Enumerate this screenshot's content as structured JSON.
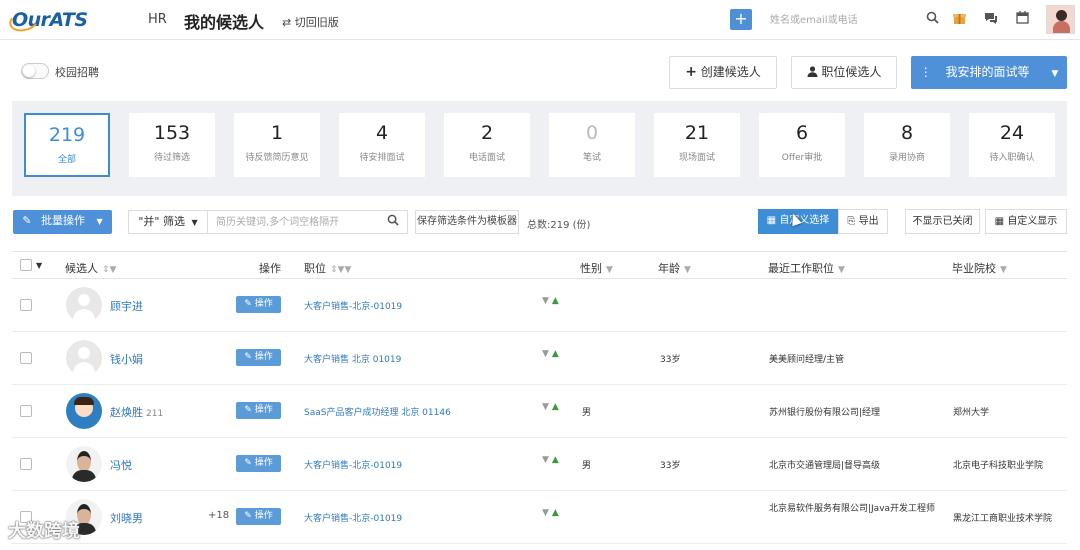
{
  "header": {
    "logo": "OurATS",
    "role": "HR",
    "title": "我的候选人",
    "switch_old": "切回旧版",
    "search_placeholder": "姓名或email或电话",
    "add_label": "+"
  },
  "toolbar": {
    "campus_toggle_label": "校园招聘",
    "create_candidate": "创建候选人",
    "position_candidates": "职位候选人",
    "my_interviews": "我安排的面试等"
  },
  "stats": [
    {
      "num": "219",
      "label": "全部"
    },
    {
      "num": "153",
      "label": "待过筛选"
    },
    {
      "num": "1",
      "label": "待反馈简历意见"
    },
    {
      "num": "4",
      "label": "待安排面试"
    },
    {
      "num": "2",
      "label": "电话面试"
    },
    {
      "num": "0",
      "label": "笔试"
    },
    {
      "num": "21",
      "label": "现场面试"
    },
    {
      "num": "6",
      "label": "Offer审批"
    },
    {
      "num": "8",
      "label": "录用协商"
    },
    {
      "num": "24",
      "label": "待入职确认"
    }
  ],
  "filters": {
    "batch_ops": "批量操作",
    "and_filter": "\"并\" 筛选",
    "search_placeholder": "简历关键词,多个词空格隔开",
    "save_filter": "保存筛选条件为模板器",
    "total": "总数:219 (份)",
    "custom_select": "自定义选择",
    "export": "导出",
    "hide_closed": "不显示已关闭",
    "custom_display": "自定义显示"
  },
  "table": {
    "headers": {
      "candidate": "候选人",
      "operation": "操作",
      "position": "职位",
      "gender": "性别",
      "age": "年龄",
      "recent_job": "最近工作职位",
      "school": "毕业院校"
    },
    "rows": [
      {
        "name": "顾宇进",
        "extra": "",
        "plus": "",
        "op": "操作",
        "position": "大客户销售-北京-01019",
        "gender": "",
        "age": "",
        "recent_job": "",
        "school": "",
        "avatar": "default"
      },
      {
        "name": "钱小娟",
        "extra": "",
        "plus": "",
        "op": "操作",
        "position": "大客户销售 北京 01019",
        "gender": "",
        "age": "33岁",
        "recent_job": "美美顾问经理/主管",
        "school": "",
        "avatar": "default"
      },
      {
        "name": "赵焕胜",
        "extra": "211",
        "plus": "",
        "op": "操作",
        "position": "SaaS产品客户成功经理 北京 01146",
        "gender": "男",
        "age": "",
        "recent_job": "苏州银行股份有限公司|经理",
        "school": "郑州大学",
        "avatar": "cartoon"
      },
      {
        "name": "冯悦",
        "extra": "",
        "plus": "",
        "op": "操作",
        "position": "大客户销售-北京-01019",
        "gender": "男",
        "age": "33岁",
        "recent_job": "北京市交通管理局|督导高级",
        "school": "北京电子科技职业学院",
        "avatar": "photo"
      },
      {
        "name": "刘晓男",
        "extra": "",
        "plus": "+18",
        "op": "操作",
        "position": "大客户销售-北京-01019",
        "gender": "",
        "age": "",
        "recent_job": "北京易软件服务有限公司|Java开发工程师",
        "school": "黑龙江工商职业技术学院",
        "avatar": "photo"
      }
    ]
  },
  "watermark": "大数跨境",
  "colors": {
    "primary": "#4f91d8",
    "link": "#2f79c0",
    "stats_bg": "#eef0f3"
  }
}
